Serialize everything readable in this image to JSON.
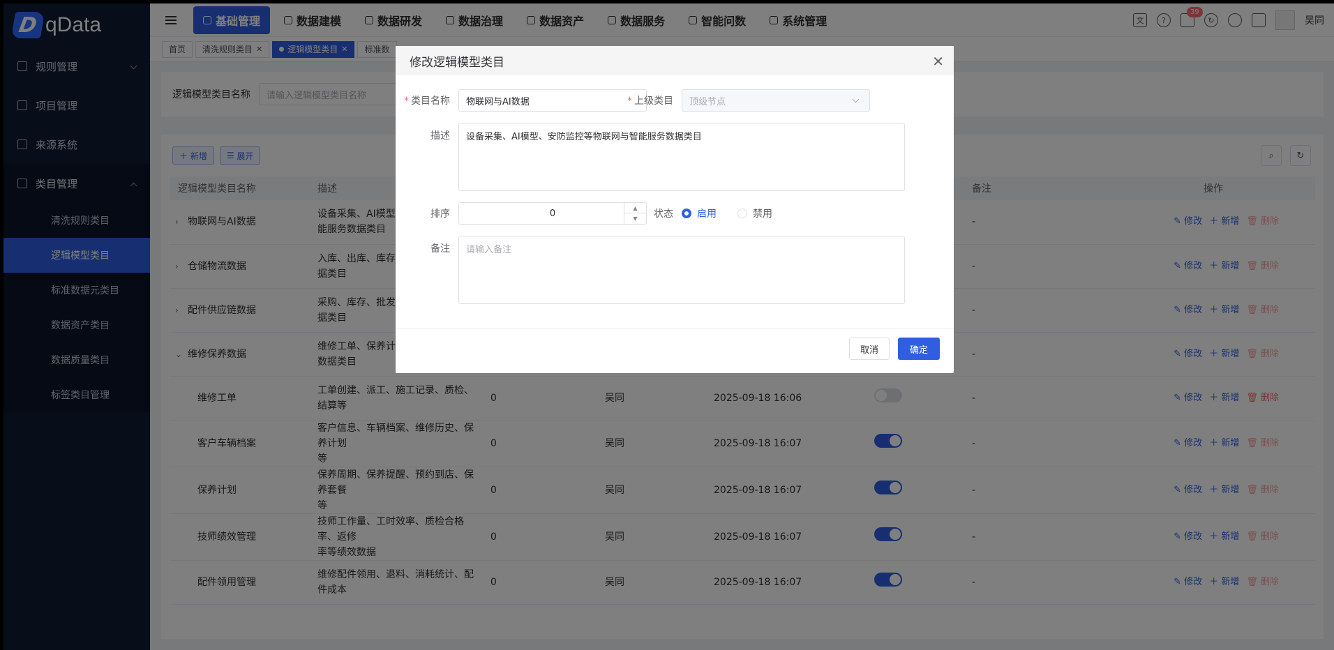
{
  "brand": {
    "name": "qData"
  },
  "sidebar": {
    "items": [
      {
        "label": "规则管理",
        "icon": "grid-icon",
        "expanded": false
      },
      {
        "label": "项目管理",
        "icon": "document-icon",
        "expanded": false
      },
      {
        "label": "来源系统",
        "icon": "cube-icon",
        "expanded": false
      },
      {
        "label": "类目管理",
        "icon": "layers-icon",
        "expanded": true
      }
    ],
    "sub_items": [
      {
        "label": "清洗规则类目"
      },
      {
        "label": "逻辑模型类目",
        "active": true
      },
      {
        "label": "标准数据元类目"
      },
      {
        "label": "数据资产类目"
      },
      {
        "label": "数据质量类目"
      },
      {
        "label": "标签类目管理"
      }
    ]
  },
  "header": {
    "nav": [
      {
        "label": "基础管理",
        "active": true
      },
      {
        "label": "数据建模"
      },
      {
        "label": "数据研发"
      },
      {
        "label": "数据治理"
      },
      {
        "label": "数据资产"
      },
      {
        "label": "数据服务"
      },
      {
        "label": "智能问数"
      },
      {
        "label": "系统管理"
      }
    ],
    "notification_count": "39",
    "user_name": "吴同"
  },
  "tabs": [
    {
      "label": "首页"
    },
    {
      "label": "清洗规则类目"
    },
    {
      "label": "逻辑模型类目",
      "active": true
    },
    {
      "label": "标准数"
    }
  ],
  "search": {
    "label": "逻辑模型类目名称",
    "placeholder": "请输入逻辑模型类目名称"
  },
  "toolbar": {
    "add_label": "新增",
    "expand_label": "展开"
  },
  "table": {
    "columns": {
      "name": "逻辑模型类目名称",
      "desc": "描述",
      "remark": "备注",
      "ops": "操作"
    },
    "op_labels": {
      "edit": "修改",
      "add": "新增",
      "delete": "删除"
    },
    "rows": [
      {
        "name": "物联网与AI数据",
        "desc": "设备采集、AI模型\n能服务数据类目",
        "sort": "",
        "creator": "",
        "time": "",
        "status": "",
        "remark": "-",
        "level": 0,
        "arrow": "›"
      },
      {
        "name": "仓储物流数据",
        "desc": "入库、出库、库存\n据类目",
        "sort": "",
        "creator": "",
        "time": "",
        "status": "",
        "remark": "-",
        "level": 0,
        "arrow": "›"
      },
      {
        "name": "配件供应链数据",
        "desc": "采购、库存、批发\n据类目",
        "sort": "",
        "creator": "",
        "time": "",
        "status": "",
        "remark": "-",
        "level": 0,
        "arrow": "›"
      },
      {
        "name": "维修保养数据",
        "desc": "维修工单、保养计\n数据类目",
        "sort": "",
        "creator": "",
        "time": "",
        "status": "",
        "remark": "-",
        "level": 0,
        "arrow": "⌄"
      },
      {
        "name": "维修工单",
        "desc": "工单创建、派工、施工记录、质检、结算等",
        "sort": "0",
        "creator": "吴同",
        "time": "2025-09-18 16:06",
        "status": "off",
        "remark": "-",
        "level": 1
      },
      {
        "name": "客户车辆档案",
        "desc": "客户信息、车辆档案、维修历史、保养计划\n等",
        "sort": "0",
        "creator": "吴同",
        "time": "2025-09-18 16:07",
        "status": "on",
        "remark": "-",
        "level": 1
      },
      {
        "name": "保养计划",
        "desc": "保养周期、保养提醒、预约到店、保养套餐\n等",
        "sort": "0",
        "creator": "吴同",
        "time": "2025-09-18 16:07",
        "status": "on",
        "remark": "-",
        "level": 1
      },
      {
        "name": "技师绩效管理",
        "desc": "技师工作量、工时效率、质检合格率、返修\n率等绩效数据",
        "sort": "0",
        "creator": "吴同",
        "time": "2025-09-18 16:07",
        "status": "on",
        "remark": "-",
        "level": 1
      },
      {
        "name": "配件领用管理",
        "desc": "维修配件领用、退料、消耗统计、配件成本",
        "sort": "0",
        "creator": "吴同",
        "time": "2025-09-18 16:07",
        "status": "on",
        "remark": "-",
        "level": 1
      }
    ]
  },
  "dialog": {
    "title": "修改逻辑模型类目",
    "name_label": "类目名称",
    "name_value": "物联网与AI数据",
    "parent_label": "上级类目",
    "parent_value": "顶级节点",
    "desc_label": "描述",
    "desc_value": "设备采集、AI模型、安防监控等物联网与智能服务数据类目",
    "sort_label": "排序",
    "sort_value": "0",
    "status_label": "状态",
    "status_enabled": "启用",
    "status_disabled": "禁用",
    "remark_label": "备注",
    "remark_placeholder": "请输入备注",
    "cancel_label": "取消",
    "ok_label": "确定"
  }
}
